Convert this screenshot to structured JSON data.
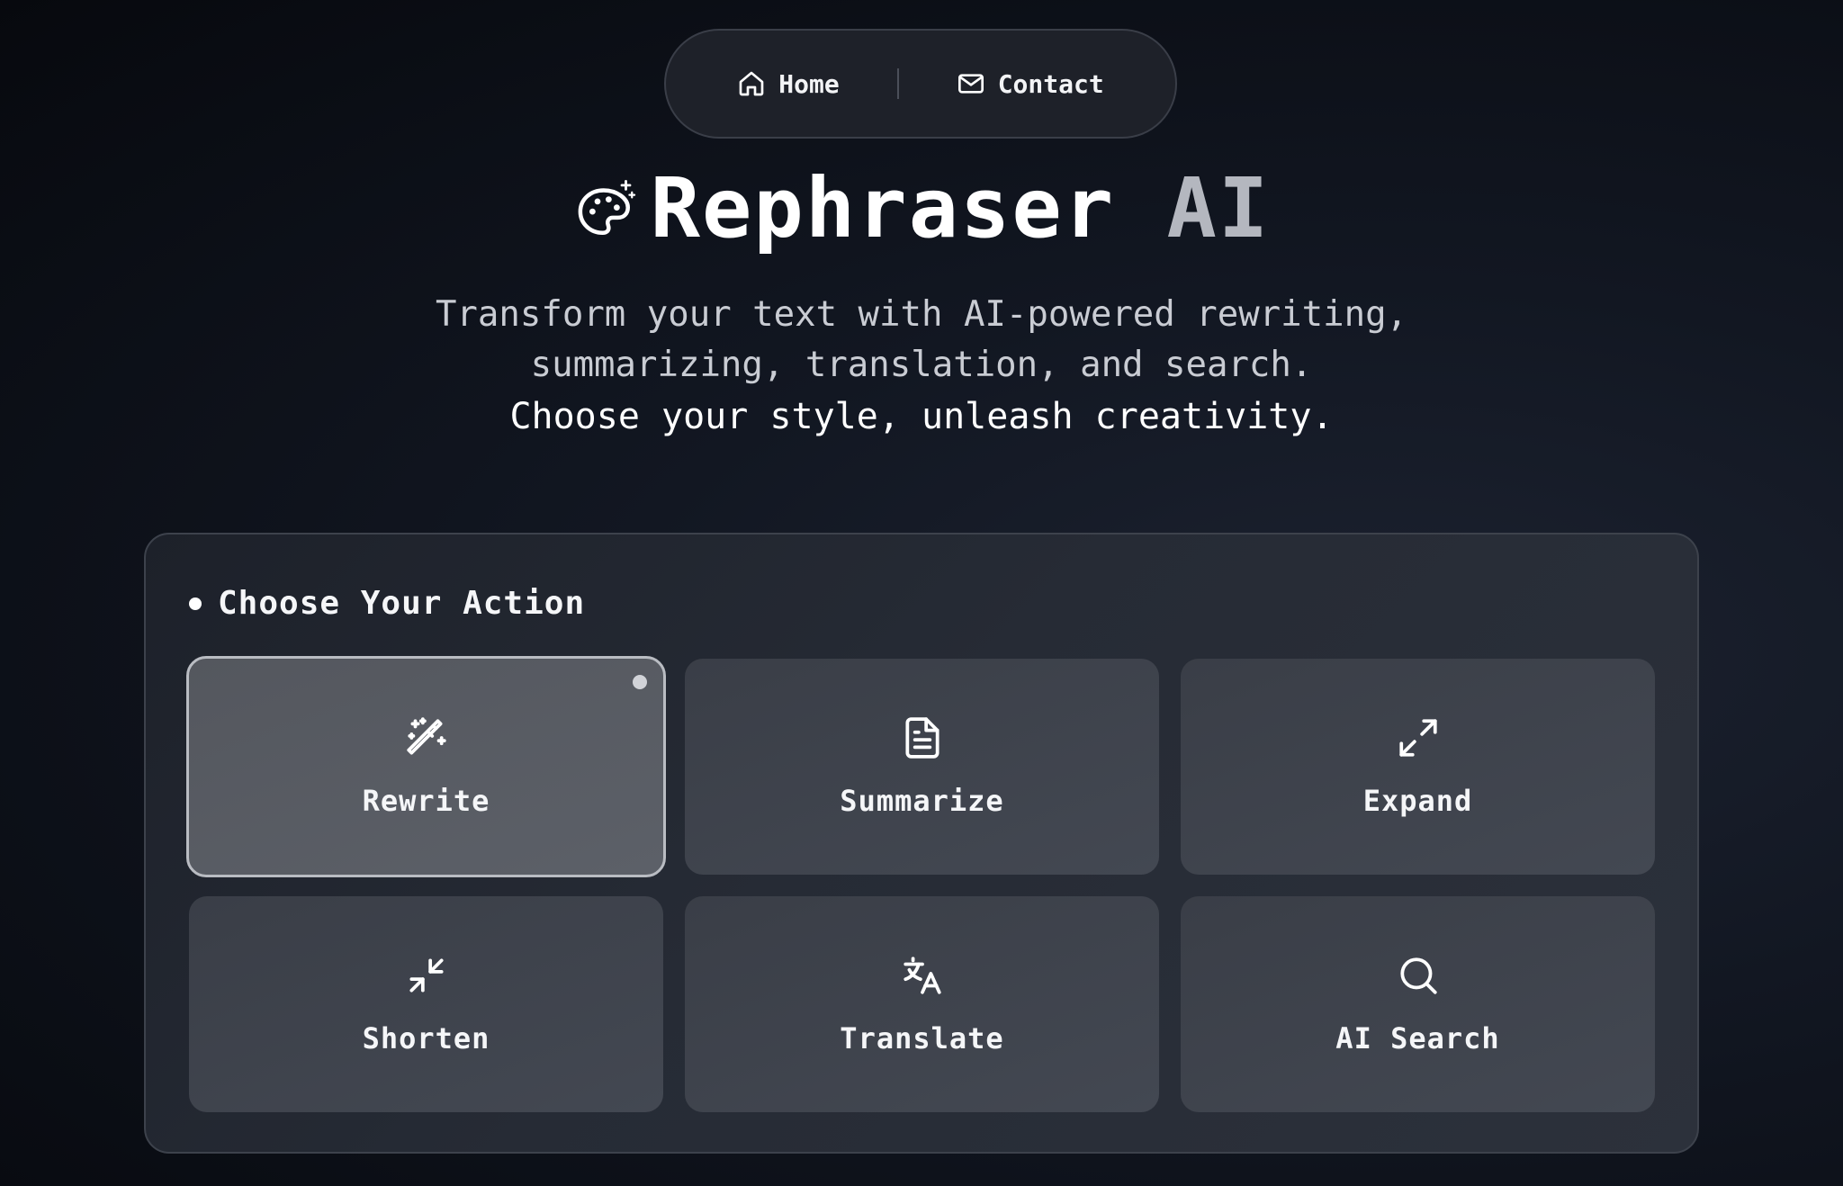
{
  "nav": {
    "home_label": "Home",
    "home_icon": "home-icon",
    "contact_label": "Contact",
    "contact_icon": "mail-icon"
  },
  "hero": {
    "icon": "palette-sparkles-icon",
    "title_main": "Rephraser",
    "title_accent": "AI",
    "subtitle_line1": "Transform your text with AI-powered rewriting,",
    "subtitle_line2": "summarizing, translation, and search.",
    "tagline": "Choose your style, unleash creativity."
  },
  "actions": {
    "heading": "Choose Your Action",
    "selected": "Rewrite",
    "items": [
      {
        "label": "Rewrite",
        "icon": "magic-wand-icon"
      },
      {
        "label": "Summarize",
        "icon": "document-icon"
      },
      {
        "label": "Expand",
        "icon": "expand-arrows-icon"
      },
      {
        "label": "Shorten",
        "icon": "shrink-arrows-icon"
      },
      {
        "label": "Translate",
        "icon": "translate-icon"
      },
      {
        "label": "AI Search",
        "icon": "search-icon"
      }
    ]
  },
  "colors": {
    "background": "#0b0e14",
    "panel": "#252a33",
    "card": "#3e424b",
    "card_selected": "#585b62",
    "title_accent": "#b4b7bf"
  }
}
